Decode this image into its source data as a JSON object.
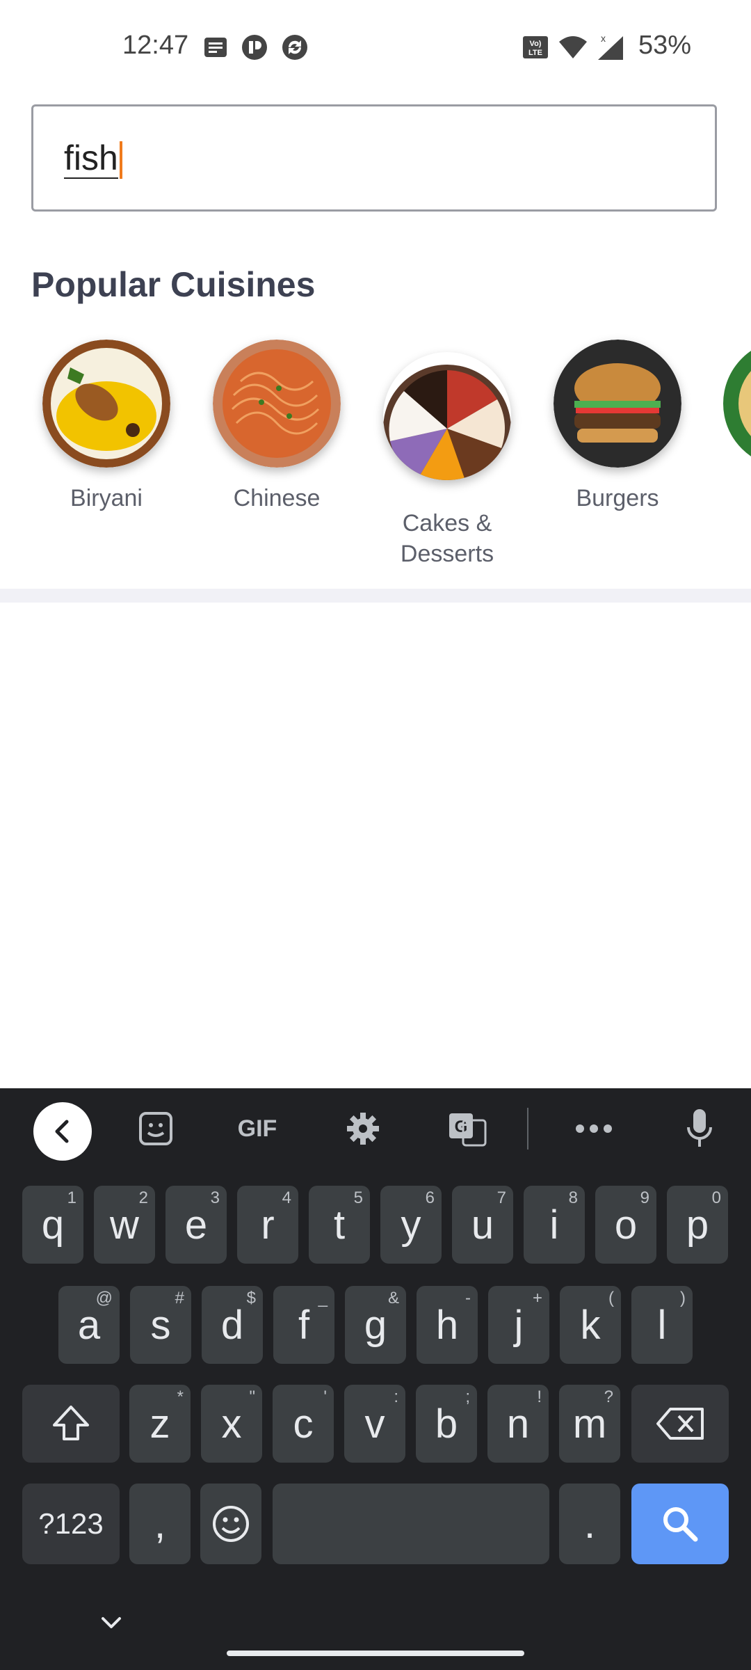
{
  "status_bar": {
    "time": "12:47",
    "battery": "53%",
    "icons": [
      "message-icon",
      "app-icon",
      "sync-icon",
      "volte-icon",
      "wifi-icon",
      "signal-icon"
    ]
  },
  "search": {
    "value": "fish"
  },
  "popular": {
    "title": "Popular Cuisines",
    "items": [
      {
        "label": "Biryani"
      },
      {
        "label": "Chinese"
      },
      {
        "label": "Cakes &\nDesserts"
      },
      {
        "label": "Burgers"
      }
    ]
  },
  "keyboard": {
    "toolbar": {
      "gif": "GIF"
    },
    "row1": [
      {
        "k": "q",
        "h": "1"
      },
      {
        "k": "w",
        "h": "2"
      },
      {
        "k": "e",
        "h": "3"
      },
      {
        "k": "r",
        "h": "4"
      },
      {
        "k": "t",
        "h": "5"
      },
      {
        "k": "y",
        "h": "6"
      },
      {
        "k": "u",
        "h": "7"
      },
      {
        "k": "i",
        "h": "8"
      },
      {
        "k": "o",
        "h": "9"
      },
      {
        "k": "p",
        "h": "0"
      }
    ],
    "row2": [
      {
        "k": "a",
        "h": "@"
      },
      {
        "k": "s",
        "h": "#"
      },
      {
        "k": "d",
        "h": "$"
      },
      {
        "k": "f",
        "h": "_"
      },
      {
        "k": "g",
        "h": "&"
      },
      {
        "k": "h",
        "h": "-"
      },
      {
        "k": "j",
        "h": "+"
      },
      {
        "k": "k",
        "h": "("
      },
      {
        "k": "l",
        "h": ")"
      }
    ],
    "row3": [
      {
        "k": "z",
        "h": "*"
      },
      {
        "k": "x",
        "h": "\""
      },
      {
        "k": "c",
        "h": "'"
      },
      {
        "k": "v",
        "h": ":"
      },
      {
        "k": "b",
        "h": ";"
      },
      {
        "k": "n",
        "h": "!"
      },
      {
        "k": "m",
        "h": "?"
      }
    ],
    "symbols_label": "?123",
    "comma": ",",
    "period": ".",
    "accent_color": "#5e97f6"
  }
}
